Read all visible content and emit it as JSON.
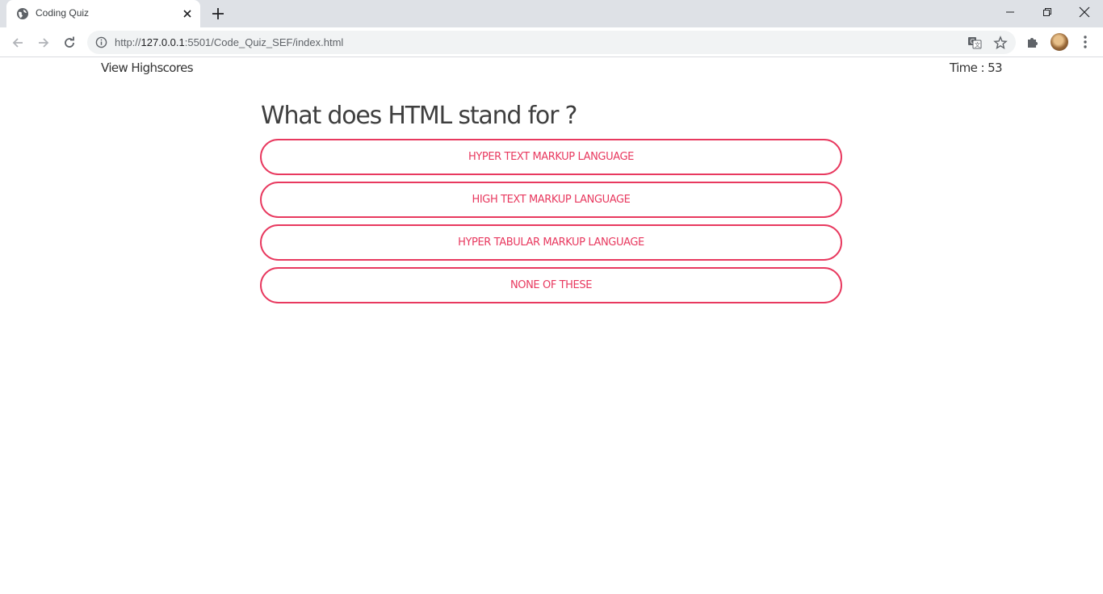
{
  "browser": {
    "tab_title": "Coding Quiz",
    "url_prefix": "http://",
    "url_host": "127.0.0.1",
    "url_rest": ":5501/Code_Quiz_SEF/index.html"
  },
  "header": {
    "highscores_link": "View Highscores",
    "timer_text": "Time : 53"
  },
  "quiz": {
    "question": "What does HTML stand for ?",
    "answers": [
      "HYPER TEXT MARKUP LANGUAGE",
      "HIGH TEXT MARKUP LANGUAGE",
      "HYPER TABULAR MARKUP LANGUAGE",
      "NONE OF THESE"
    ]
  },
  "colors": {
    "accent": "#e8395f",
    "text": "#3f3f3f",
    "chrome_bg": "#dee1e6"
  }
}
